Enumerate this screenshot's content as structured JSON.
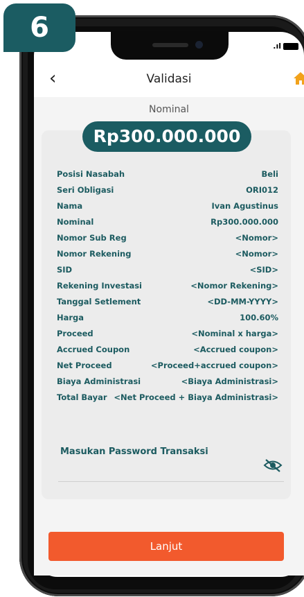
{
  "step_badge": "6",
  "status": {
    "signal": ".ıl"
  },
  "header": {
    "title": "Validasi"
  },
  "summary": {
    "label": "Nominal",
    "amount": "Rp300.000.000"
  },
  "details": [
    {
      "key": "Posisi Nasabah",
      "value": "Beli"
    },
    {
      "key": "Seri Obligasi",
      "value": "ORI012"
    },
    {
      "key": "Nama",
      "value": "Ivan Agustinus"
    },
    {
      "key": "Nominal",
      "value": "Rp300.000.000"
    },
    {
      "key": "Nomor Sub Reg",
      "value": "<Nomor>"
    },
    {
      "key": "Nomor Rekening",
      "value": "<Nomor>"
    },
    {
      "key": "SID",
      "value": "<SID>"
    },
    {
      "key": "Rekening Investasi",
      "value": "<Nomor Rekening>"
    },
    {
      "key": "Tanggal Setlement",
      "value": "<DD-MM-YYYY>"
    },
    {
      "key": "Harga",
      "value": "100.60%"
    },
    {
      "key": "Proceed",
      "value": "<Nominal x harga>"
    },
    {
      "key": "Accrued Coupon",
      "value": "<Accrued coupon>"
    },
    {
      "key": "Net Proceed",
      "value": "<Proceed+accrued coupon>"
    },
    {
      "key": "Biaya Administrasi",
      "value": "<Biaya Administrasi>"
    },
    {
      "key": "Total Bayar",
      "value": "<Net Proceed + Biaya Administrasi>"
    }
  ],
  "password": {
    "label": "Masukan Password Transaksi"
  },
  "submit": {
    "label": "Lanjut"
  },
  "colors": {
    "primary": "#1b5c62",
    "accent": "#f25a2d"
  }
}
